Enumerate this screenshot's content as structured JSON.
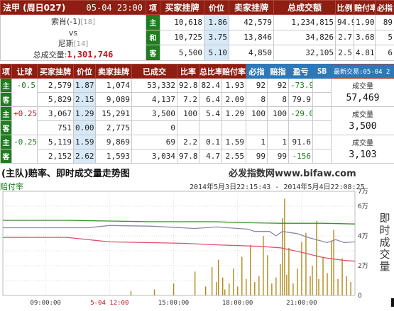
{
  "top": {
    "match": "法甲 (周日027)",
    "datetime": "05-04 23:00",
    "headers": {
      "bet": "项",
      "buy": "买家挂牌",
      "price": "价位",
      "sell": "卖家挂牌",
      "total_volume": "总成交额",
      "ratio": "比例",
      "payout": "赔付率",
      "bifa": "必指"
    },
    "home_team": "索肖(-1)",
    "home_rank": "[18]",
    "vs": "vs",
    "away_team": "尼斯",
    "away_rank": "[14]",
    "volume_label": "总成交量:",
    "volume_value": "1,301,746",
    "rows": [
      {
        "tag": "主",
        "buy": "10,618",
        "price": "1.86",
        "sell": "42,579",
        "total": "1,234,815",
        "ratio": "94.9",
        "payout": "1.90",
        "bifa": "89"
      },
      {
        "tag": "和",
        "buy": "10,725",
        "price": "3.75",
        "sell": "13,846",
        "total": "34,826",
        "ratio": "2.7",
        "payout": "3.68",
        "bifa": "5"
      },
      {
        "tag": "客",
        "buy": "5,500",
        "price": "5.10",
        "sell": "4,850",
        "total": "32,105",
        "ratio": "2.5",
        "payout": "4.81",
        "bifa": "6"
      }
    ]
  },
  "handicap": {
    "headers": {
      "bet": "项",
      "handicap": "让球",
      "buy": "买家挂牌",
      "price": "价位",
      "sell": "卖家挂牌",
      "traded": "已成交",
      "ratio": "比率",
      "total_ratio": "总比率",
      "payout": "赔付率",
      "bizhi": "必指",
      "peizhi": "赔指",
      "pnl": "盈亏",
      "sb": "SB",
      "updated": "最新交易:05-04 2"
    },
    "volume_label": "成交量",
    "groups": [
      {
        "handicap": "-0.5",
        "volume": "57,469",
        "rows": [
          {
            "tag": "主",
            "buy": "2,579",
            "price": "1.87",
            "sell": "1,074",
            "traded": "53,332",
            "ratio": "92.8",
            "total_ratio": "82.4",
            "payout": "1.93",
            "bizhi": "92",
            "peizhi": "92",
            "pnl": "-73.9"
          },
          {
            "tag": "客",
            "buy": "5,829",
            "price": "2.15",
            "sell": "9,089",
            "traded": "4,137",
            "ratio": "7.2",
            "total_ratio": "6.4",
            "payout": "2.09",
            "bizhi": "8",
            "peizhi": "8",
            "pnl": "79.9"
          }
        ]
      },
      {
        "handicap": "+0.25",
        "volume": "3,500",
        "rows": [
          {
            "tag": "主",
            "buy": "3,067",
            "price": "1.29",
            "sell": "15,291",
            "traded": "3,500",
            "ratio": "100",
            "total_ratio": "5.4",
            "payout": "1.29",
            "bizhi": "100",
            "peizhi": "100",
            "pnl": "-29.0"
          },
          {
            "tag": "客",
            "buy": "751",
            "price": "0.00",
            "sell": "2,775",
            "traded": "0",
            "ratio": "",
            "total_ratio": "",
            "payout": "",
            "bizhi": "",
            "peizhi": "",
            "pnl": ""
          }
        ]
      },
      {
        "handicap": "-0.25",
        "volume": "3,103",
        "rows": [
          {
            "tag": "主",
            "buy": "5,119",
            "price": "1.59",
            "sell": "9,869",
            "traded": "69",
            "ratio": "2.2",
            "total_ratio": "0.1",
            "payout": "1.59",
            "bizhi": "1",
            "peizhi": "1",
            "pnl": "91.6"
          },
          {
            "tag": "客",
            "buy": "2,152",
            "price": "2.62",
            "sell": "1,593",
            "traded": "3,034",
            "ratio": "97.8",
            "total_ratio": "4.7",
            "payout": "2.55",
            "bizhi": "99",
            "peizhi": "99",
            "pnl": "-156"
          }
        ]
      }
    ]
  },
  "chart": {
    "title": "(主队)赔率、即时成交量走势图",
    "site": "必发指数网www.bifaw.com",
    "range": "2014年5月3日22:15:43 - 2014年5月4日22:08:25",
    "legend": "赔付率",
    "ylabel_right": "即时成交量",
    "colors": {
      "green": "#3a8f2e",
      "gray": "#8888aa",
      "red": "#e0506a",
      "bar": "#b08a1a",
      "kickoff": "#c1121f"
    }
  },
  "chart_data": {
    "type": "line",
    "x_tick_labels": [
      "09:00:00",
      "5-04 12:00",
      "15:00:00",
      "18:00:00",
      "21:00:00"
    ],
    "y_tick_labels": [
      "0",
      "2万",
      "4万",
      "6万",
      "7万"
    ],
    "series": [
      {
        "color": "green",
        "values": [
          [
            0,
            5.05
          ],
          [
            30,
            5.05
          ],
          [
            50,
            5.0
          ],
          [
            70,
            4.95
          ],
          [
            100,
            4.95
          ],
          [
            110,
            4.9
          ],
          [
            130,
            4.85
          ],
          [
            150,
            4.85
          ],
          [
            165,
            4.8
          ]
        ]
      },
      {
        "color": "gray",
        "values": [
          [
            0,
            4.55
          ],
          [
            40,
            4.55
          ],
          [
            50,
            4.7
          ],
          [
            70,
            4.65
          ],
          [
            90,
            4.5
          ],
          [
            100,
            4.6
          ],
          [
            115,
            4.45
          ],
          [
            118,
            4.3
          ],
          [
            125,
            4.3
          ],
          [
            128,
            4.0
          ],
          [
            131,
            4.3
          ],
          [
            138,
            4.15
          ],
          [
            143,
            3.9
          ],
          [
            148,
            3.7
          ],
          [
            152,
            3.55
          ],
          [
            156,
            3.75
          ],
          [
            160,
            3.55
          ],
          [
            165,
            3.6
          ]
        ]
      },
      {
        "color": "red",
        "values": [
          [
            0,
            3.9
          ],
          [
            30,
            3.9
          ],
          [
            50,
            3.6
          ],
          [
            85,
            3.5
          ],
          [
            100,
            3.4
          ],
          [
            120,
            3.3
          ],
          [
            130,
            3.2
          ],
          [
            140,
            2.9
          ],
          [
            150,
            2.55
          ],
          [
            160,
            2.35
          ],
          [
            165,
            2.3
          ]
        ]
      }
    ],
    "bars": [
      [
        60,
        0.3
      ],
      [
        71,
        0.4
      ],
      [
        80,
        0.8
      ],
      [
        90,
        1.6
      ],
      [
        95,
        0.6
      ],
      [
        98,
        1.9
      ],
      [
        100,
        0.9
      ],
      [
        101,
        2.4
      ],
      [
        103,
        1.2
      ],
      [
        104,
        0.4
      ],
      [
        106,
        0.8
      ],
      [
        108,
        1.8
      ],
      [
        110,
        0.6
      ],
      [
        112,
        2.6
      ],
      [
        114,
        1.1
      ],
      [
        116,
        3.4
      ],
      [
        118,
        0.9
      ],
      [
        120,
        1.3
      ],
      [
        122,
        4.0
      ],
      [
        124,
        2.7
      ],
      [
        126,
        0.8
      ],
      [
        128,
        1.2
      ],
      [
        130,
        2.1
      ],
      [
        131,
        5.2
      ],
      [
        132,
        6.5
      ],
      [
        133,
        1.4
      ],
      [
        134,
        3.2
      ],
      [
        136,
        0.8
      ],
      [
        138,
        1.8
      ],
      [
        140,
        3.6
      ],
      [
        142,
        4.2
      ],
      [
        144,
        1.3
      ],
      [
        145,
        2.0
      ],
      [
        147,
        5.0
      ],
      [
        148,
        1.1
      ],
      [
        150,
        2.6
      ],
      [
        152,
        1.5
      ],
      [
        154,
        3.7
      ],
      [
        155,
        4.4
      ],
      [
        157,
        1.1
      ],
      [
        159,
        2.5
      ],
      [
        161,
        1.3
      ],
      [
        163,
        0.9
      ]
    ],
    "x_range": [
      0,
      165
    ],
    "y_range": [
      0,
      7
    ]
  }
}
